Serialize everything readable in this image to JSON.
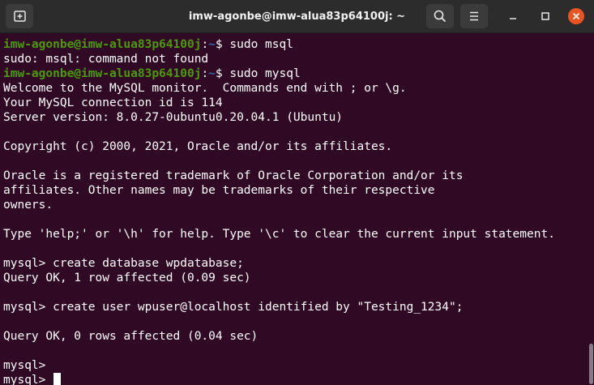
{
  "window": {
    "title": "imw-agonbe@imw-alua83p64100j: ~"
  },
  "icons": {
    "new_tab": "new-tab-icon",
    "search": "search-icon",
    "menu": "hamburger-menu-icon",
    "minimize": "minimize-icon",
    "maximize": "maximize-icon",
    "close": "close-icon"
  },
  "colors": {
    "background": "#300a24",
    "prompt_user": "#4e9a06",
    "prompt_path": "#3465a4",
    "close_button": "#e95420",
    "text": "#ffffff"
  },
  "terminal": {
    "lines": [
      {
        "type": "prompt",
        "user": "imw-agonbe@imw-alua83p64100j",
        "sep": ":",
        "path": "~",
        "symbol": "$ ",
        "cmd": "sudo msql"
      },
      {
        "type": "text",
        "text": "sudo: msql: command not found"
      },
      {
        "type": "prompt",
        "user": "imw-agonbe@imw-alua83p64100j",
        "sep": ":",
        "path": "~",
        "symbol": "$ ",
        "cmd": "sudo mysql"
      },
      {
        "type": "text",
        "text": "Welcome to the MySQL monitor.  Commands end with ; or \\g."
      },
      {
        "type": "text",
        "text": "Your MySQL connection id is 114"
      },
      {
        "type": "text",
        "text": "Server version: 8.0.27-0ubuntu0.20.04.1 (Ubuntu)"
      },
      {
        "type": "text",
        "text": ""
      },
      {
        "type": "text",
        "text": "Copyright (c) 2000, 2021, Oracle and/or its affiliates."
      },
      {
        "type": "text",
        "text": ""
      },
      {
        "type": "text",
        "text": "Oracle is a registered trademark of Oracle Corporation and/or its"
      },
      {
        "type": "text",
        "text": "affiliates. Other names may be trademarks of their respective"
      },
      {
        "type": "text",
        "text": "owners."
      },
      {
        "type": "text",
        "text": ""
      },
      {
        "type": "text",
        "text": "Type 'help;' or '\\h' for help. Type '\\c' to clear the current input statement."
      },
      {
        "type": "text",
        "text": ""
      },
      {
        "type": "text",
        "text": "mysql> create database wpdatabase;"
      },
      {
        "type": "text",
        "text": "Query OK, 1 row affected (0.09 sec)"
      },
      {
        "type": "text",
        "text": ""
      },
      {
        "type": "text",
        "text": "mysql> create user wpuser@localhost identified by \"Testing_1234\";"
      },
      {
        "type": "text",
        "text": ""
      },
      {
        "type": "text",
        "text": "Query OK, 0 rows affected (0.04 sec)"
      },
      {
        "type": "text",
        "text": ""
      },
      {
        "type": "text",
        "text": "mysql> "
      },
      {
        "type": "text",
        "text": "mysql> ",
        "cursor": true
      }
    ]
  }
}
